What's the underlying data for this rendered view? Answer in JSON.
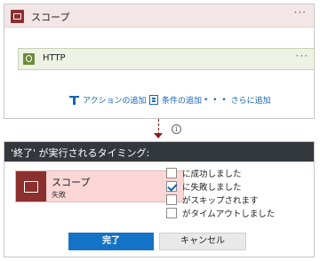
{
  "scope": {
    "title": "スコープ",
    "menu": "···",
    "http": {
      "title": "HTTP",
      "menu": "···"
    },
    "actions": [
      {
        "label": "アクションの追加",
        "icon": "add-action-icon"
      },
      {
        "label": "条件の追加",
        "icon": "add-condition-icon"
      },
      {
        "label": "さらに追加",
        "icon": "more-dots-icon"
      }
    ],
    "more_dots": "• • •"
  },
  "connector": {
    "info_glyph": "i"
  },
  "run_after": {
    "title": "'終了' が実行されるタイミング:",
    "source": {
      "title": "スコープ",
      "status": "失敗"
    },
    "options": [
      {
        "label": "に成功しました",
        "checked": false
      },
      {
        "label": "に失敗しました",
        "checked": true
      },
      {
        "label": "がスキップされます",
        "checked": false
      },
      {
        "label": "がタイムアウトしました",
        "checked": false
      }
    ],
    "done_label": "完了",
    "cancel_label": "キャンセル"
  },
  "colors": {
    "scope_header_bg": "#f3e6e6",
    "scope_icon": "#8b2f2f",
    "http_bg": "#eef2e4",
    "http_icon": "#6f8b3a",
    "link_blue": "#1664b8",
    "dialog_header": "#33383d",
    "failed_bg": "#fbd6d6",
    "primary_button": "#1573c7"
  }
}
